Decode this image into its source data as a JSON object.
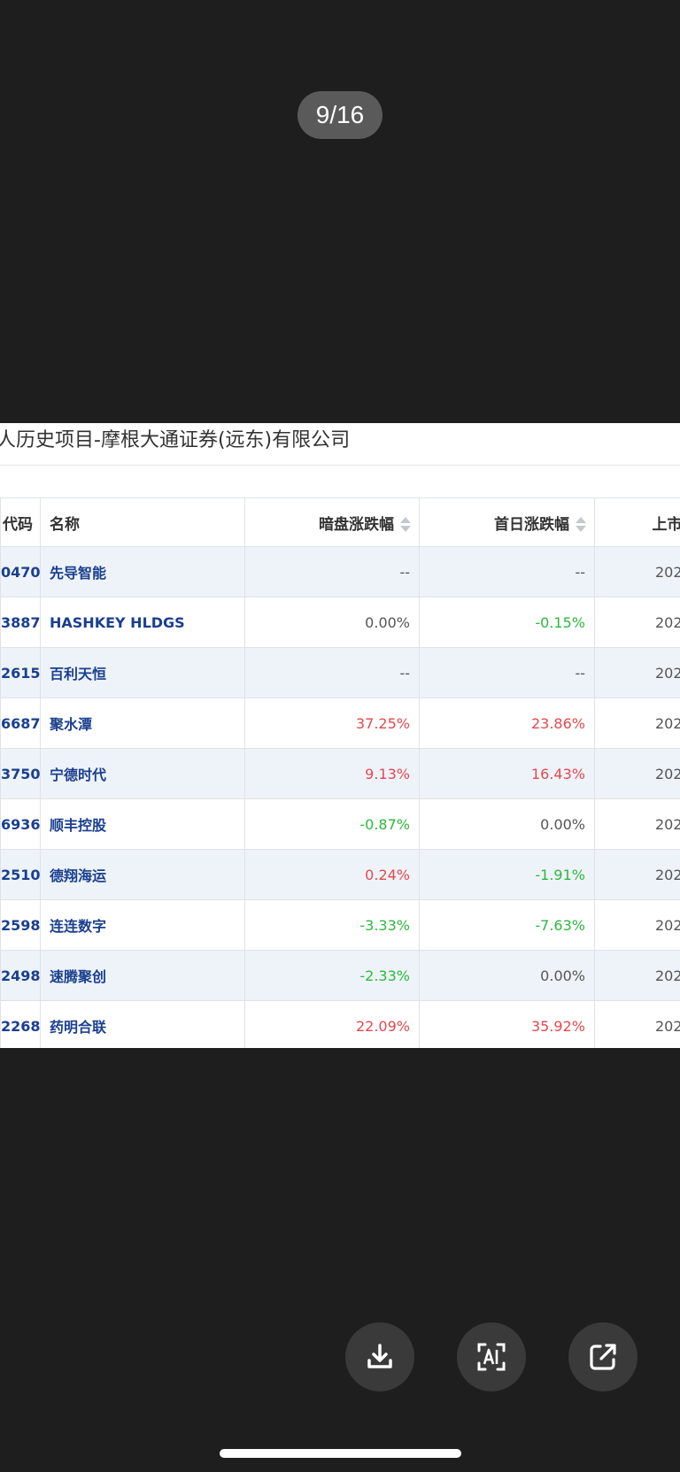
{
  "viewer": {
    "counter": "9/16"
  },
  "image": {
    "title": "人历史项目-摩根大通证券(远东)有限公司",
    "table": {
      "headers": {
        "code": "代码",
        "name": "名称",
        "dark_pool_change": "暗盘涨跌幅",
        "first_day_change": "首日涨跌幅",
        "listing_date": "上市"
      },
      "rows": [
        {
          "code": "0470",
          "name": "先导智能",
          "dark": "--",
          "dark_color": "neutral",
          "first": "--",
          "first_color": "neutral",
          "date": "202"
        },
        {
          "code": "3887",
          "name": "HASHKEY HLDGS",
          "dark": "0.00%",
          "dark_color": "neutral",
          "first": "-0.15%",
          "first_color": "green",
          "date": "202"
        },
        {
          "code": "2615",
          "name": "百利天恒",
          "dark": "--",
          "dark_color": "neutral",
          "first": "--",
          "first_color": "neutral",
          "date": "202"
        },
        {
          "code": "6687",
          "name": "聚水潭",
          "dark": "37.25%",
          "dark_color": "red",
          "first": "23.86%",
          "first_color": "red",
          "date": "202"
        },
        {
          "code": "3750",
          "name": "宁德时代",
          "dark": "9.13%",
          "dark_color": "red",
          "first": "16.43%",
          "first_color": "red",
          "date": "202"
        },
        {
          "code": "6936",
          "name": "顺丰控股",
          "dark": "-0.87%",
          "dark_color": "green",
          "first": "0.00%",
          "first_color": "neutral",
          "date": "202"
        },
        {
          "code": "2510",
          "name": "德翔海运",
          "dark": "0.24%",
          "dark_color": "red",
          "first": "-1.91%",
          "first_color": "green",
          "date": "202"
        },
        {
          "code": "2598",
          "name": "连连数字",
          "dark": "-3.33%",
          "dark_color": "green",
          "first": "-7.63%",
          "first_color": "green",
          "date": "202"
        },
        {
          "code": "2498",
          "name": "速腾聚创",
          "dark": "-2.33%",
          "dark_color": "green",
          "first": "0.00%",
          "first_color": "neutral",
          "date": "202"
        },
        {
          "code": "2268",
          "name": "药明合联",
          "dark": "22.09%",
          "dark_color": "red",
          "first": "35.92%",
          "first_color": "red",
          "date": "202"
        }
      ]
    }
  },
  "actions": [
    {
      "name": "download-button",
      "icon": "download-icon"
    },
    {
      "name": "ai-text-button",
      "icon": "ai-scan-icon"
    },
    {
      "name": "share-button",
      "icon": "share-icon"
    }
  ],
  "colors": {
    "background": "#1e1e1e",
    "red": "#e5484d",
    "green": "#2db83d",
    "neutral": "#555555",
    "link": "#1a3f8f"
  }
}
